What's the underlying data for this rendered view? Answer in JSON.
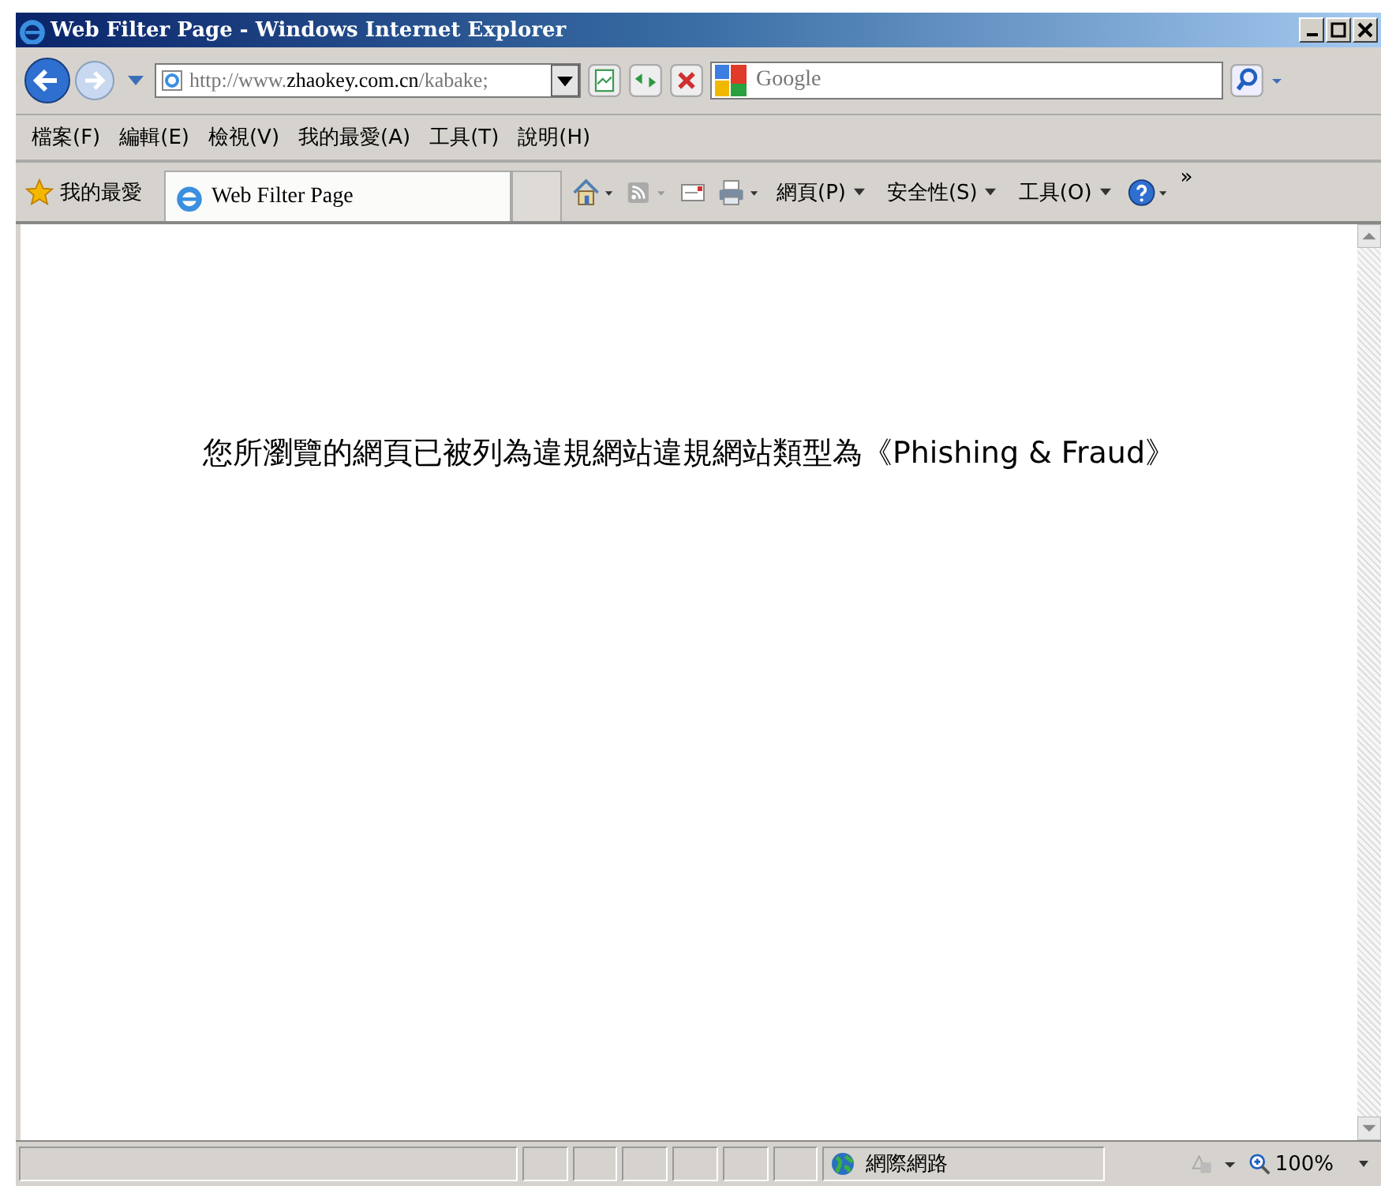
{
  "window": {
    "title": "Web Filter Page - Windows Internet Explorer"
  },
  "address": {
    "value": "http://www.**zhaokey.com.cn**/kabake;"
  },
  "search": {
    "placeholder": "Google"
  },
  "menu": [
    "檔案(F)",
    "編輯(E)",
    "檢視(V)",
    "我的最愛(A)",
    "工具(T)",
    "說明(H)"
  ],
  "favorites": {
    "label": "我的最愛"
  },
  "tab": {
    "title": "Web Filter Page",
    "selected": true
  },
  "commands": [
    {
      "kind": "home"
    },
    {
      "kind": "feed"
    },
    {
      "kind": "mail"
    },
    {
      "kind": "print"
    },
    {
      "kind": "menu",
      "label": "網頁(P)"
    },
    {
      "kind": "menu",
      "label": "安全性(S)"
    },
    {
      "kind": "menu",
      "label": "工具(O)"
    },
    {
      "kind": "help"
    }
  ],
  "overflow": "»",
  "message": "您所瀏覽的網頁已被列為違規網站違規網站類型為《Phishing & Fraud》",
  "status_bar": {
    "zone": "網際網路",
    "zoom": "100%"
  }
}
